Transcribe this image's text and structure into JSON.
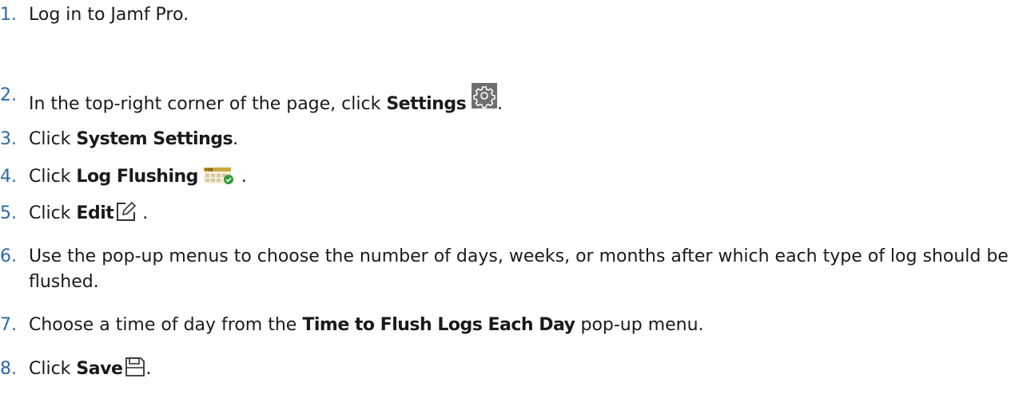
{
  "steps": [
    {
      "number": "1.",
      "before": "Log in to Jamf Pro."
    },
    {
      "number": "2.",
      "before": "In the top-right corner of the page, click ",
      "bold": "Settings",
      "icon": "gear-icon",
      "after": "."
    },
    {
      "number": "3.",
      "before": "Click ",
      "bold": "System Settings",
      "after": "."
    },
    {
      "number": "4.",
      "before": "Click ",
      "bold": "Log Flushing",
      "icon": "calendar-icon",
      "after": ".",
      "icon_text": "FEB"
    },
    {
      "number": "5.",
      "before": "Click ",
      "bold": "Edit",
      "icon": "edit-icon",
      "after": "."
    },
    {
      "number": "6.",
      "before": "Use the pop-up menus to choose the number of days, weeks, or months after which each type of log should be flushed."
    },
    {
      "number": "7.",
      "before": "Choose a time of day from the ",
      "bold": "Time to Flush Logs Each Day",
      "after": " pop-up menu."
    },
    {
      "number": "8.",
      "before": "Click ",
      "bold": "Save",
      "icon": "save-icon",
      "after": "."
    }
  ],
  "colors": {
    "number": "#2b6aa8",
    "text": "#1a1a1a"
  }
}
